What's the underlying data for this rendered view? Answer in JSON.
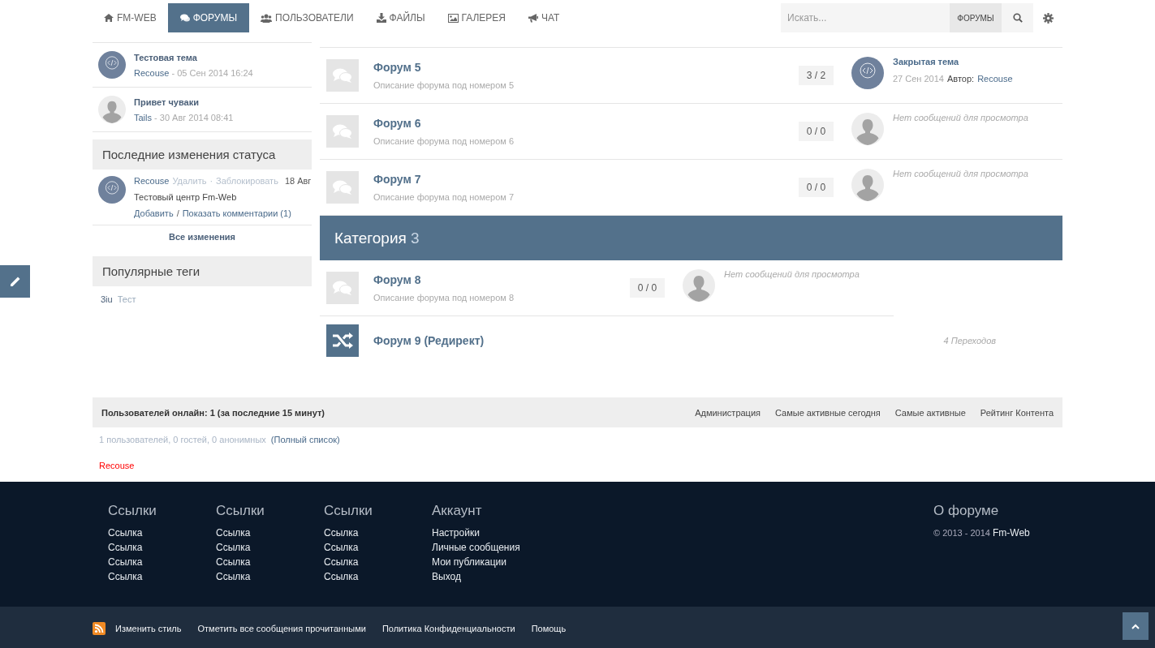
{
  "navbar": {
    "brand": "FM-WEB",
    "tabs": [
      {
        "label": "ФОРУМЫ",
        "selected": true
      },
      {
        "label": "ПОЛЬЗОВАТЕЛИ",
        "selected": false
      },
      {
        "label": "ФАЙЛЫ",
        "selected": false
      },
      {
        "label": "ГАЛЕРЕЯ",
        "selected": false
      },
      {
        "label": "ЧАТ",
        "selected": false
      }
    ],
    "search": {
      "placeholder": "Искать...",
      "scope": "ФОРУМЫ"
    }
  },
  "sidebar": {
    "recent_topics": [
      {
        "title": "Тестовая тема",
        "author": "Recouse",
        "date": "- 05 Сен 2014 16:24",
        "kind": "code"
      },
      {
        "title": "Привет чуваки",
        "author": "Tails",
        "date": "- 30 Авг 2014 08:41",
        "kind": "silhouette"
      }
    ],
    "status_updates": {
      "title": "Последние изменения статуса",
      "items": [
        {
          "user": "Recouse",
          "actions": [
            "Удалить",
            "·",
            "Заблокировать"
          ],
          "date": "18 Авг",
          "text": "Тестовый центр Fm-Web",
          "add_link": "Добавить",
          "separator": "/",
          "comments_link": "Показать комментарии (1)",
          "kind": "code"
        }
      ],
      "all_link": "Все изменения"
    },
    "tags": {
      "title": "Популярные теги",
      "items": [
        {
          "label": "3iu",
          "selected": true
        },
        {
          "label": "Тест",
          "selected": false
        }
      ]
    }
  },
  "sections": [
    {
      "forums": [
        {
          "kind": "forum",
          "title": "Форум 5",
          "description": "Описание форума под номером 5",
          "counts": "3 / 2",
          "last": {
            "kind": "code",
            "title": "Закрытая тема",
            "date": "27 Сен 2014",
            "author_label": "Автор:",
            "author": "Recouse"
          }
        },
        {
          "kind": "forum",
          "title": "Форум 6",
          "description": "Описание форума под номером 6",
          "counts": "0 / 0",
          "last": {
            "kind": "silhouette",
            "empty": "Нет сообщений для просмотра"
          }
        },
        {
          "kind": "forum",
          "title": "Форум 7",
          "description": "Описание форума под номером 7",
          "counts": "0 / 0",
          "last": {
            "kind": "silhouette",
            "empty": "Нет сообщений для просмотра"
          }
        }
      ]
    },
    {
      "category": {
        "title": "Категория",
        "number": "3"
      },
      "forums": [
        {
          "kind": "forum",
          "title": "Форум 8",
          "description": "Описание форума под номером 8",
          "counts": "0 / 0",
          "last": {
            "kind": "silhouette",
            "empty": "Нет сообщений для просмотра"
          }
        },
        {
          "kind": "redirect",
          "title": "Форум 9 (Редирект)",
          "redirects": "4 Переходов"
        }
      ]
    }
  ],
  "stats": {
    "title": "Пользователей онлайн: 1 (за последние 15 минут)",
    "links": [
      "Администрация",
      "Самые активные сегодня",
      "Самые активные",
      "Рейтинг Контента"
    ],
    "summary": "1 пользователей, 0 гостей, 0 анонимных",
    "full_list": "(Полный список)",
    "online_users": [
      {
        "name": "Recouse",
        "color": "#ff0000"
      }
    ]
  },
  "footer": {
    "columns": [
      {
        "title": "Ссылки",
        "links": [
          "Ссылка",
          "Ссылка",
          "Ссылка",
          "Ссылка"
        ]
      },
      {
        "title": "Ссылки",
        "links": [
          "Ссылка",
          "Ссылка",
          "Ссылка",
          "Ссылка"
        ]
      },
      {
        "title": "Ссылки",
        "links": [
          "Ссылка",
          "Ссылка",
          "Ссылка",
          "Ссылка"
        ]
      },
      {
        "title": "Аккаунт",
        "links": [
          "Настройки",
          "Личные сообщения",
          "Мои публикации",
          "Выход"
        ]
      }
    ],
    "about": {
      "title": "О форуме",
      "copyright": "© 2013 - 2014",
      "site": "Fm-Web"
    },
    "bottom_links": [
      "Изменить стиль",
      "Отметить все сообщения прочитанными",
      "Политика Конфиденциальности",
      "Помощь"
    ]
  }
}
